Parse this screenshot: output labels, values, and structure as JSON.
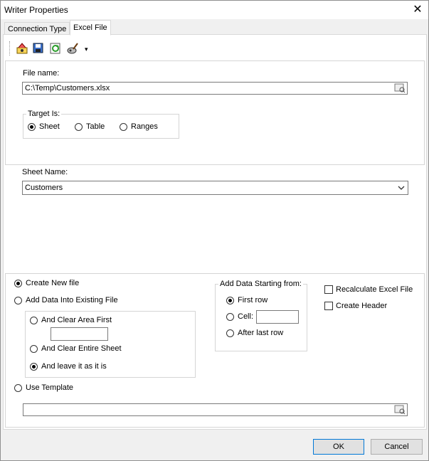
{
  "window": {
    "title": "Writer Properties"
  },
  "tabs": [
    {
      "label": "Connection Type",
      "active": false
    },
    {
      "label": "Excel File",
      "active": true
    }
  ],
  "toolbar": {
    "icons": [
      "wizard-icon",
      "save-icon",
      "refresh-icon",
      "brush-icon"
    ],
    "more_glyph": "▾"
  },
  "file": {
    "label": "File name:",
    "value": "C:\\Temp\\Customers.xlsx"
  },
  "target": {
    "legend": "Target Is:",
    "options": [
      {
        "label": "Sheet",
        "selected": true
      },
      {
        "label": "Table",
        "selected": false
      },
      {
        "label": "Ranges",
        "selected": false
      }
    ]
  },
  "sheet": {
    "label": "Sheet Name:",
    "value": "Customers"
  },
  "mode": {
    "create_new": "Create New file",
    "add_existing": "Add Data Into Existing File",
    "clear_area": "And Clear Area First",
    "clear_sheet": "And Clear Entire Sheet",
    "leave": "And leave it as it is",
    "use_template": "Use Template"
  },
  "starting": {
    "legend": "Add Data Starting from:",
    "first_row": "First row",
    "cell": "Cell:",
    "after_last": "After last row"
  },
  "options": {
    "recalculate": "Recalculate Excel File",
    "create_header": "Create Header"
  },
  "buttons": {
    "ok": "OK",
    "cancel": "Cancel"
  },
  "colors": {
    "accent": "#0078d7",
    "window_bg": "#f0f0f0",
    "panel_bg": "#ffffff"
  }
}
